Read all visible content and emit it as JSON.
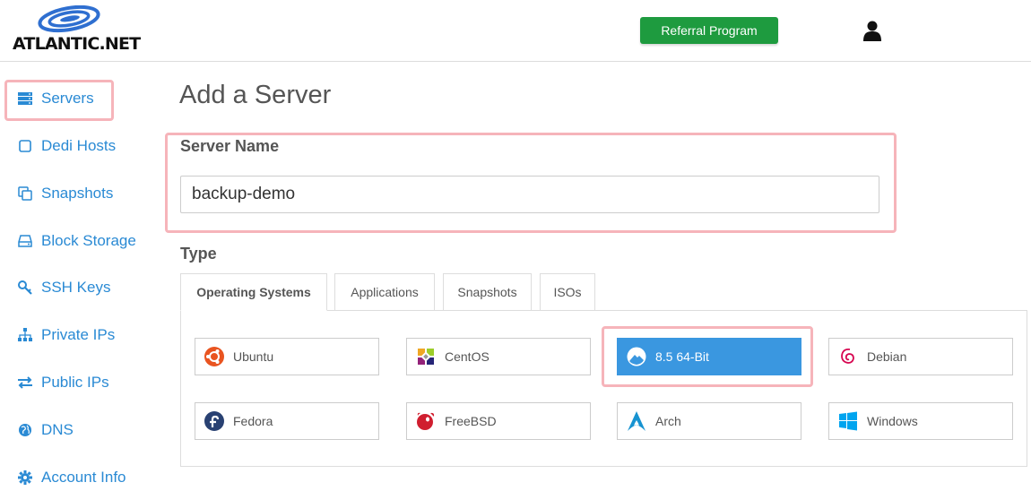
{
  "header": {
    "logo_text": "ATLANTIC.NET",
    "referral_label": "Referral Program",
    "user_icon": "user-icon"
  },
  "sidebar": {
    "items": [
      {
        "label": "Servers",
        "icon": "servers-icon",
        "active": true
      },
      {
        "label": "Dedi Hosts",
        "icon": "square-icon"
      },
      {
        "label": "Snapshots",
        "icon": "copy-icon"
      },
      {
        "label": "Block Storage",
        "icon": "hdd-icon"
      },
      {
        "label": "SSH Keys",
        "icon": "key-icon"
      },
      {
        "label": "Private IPs",
        "icon": "sitemap-icon"
      },
      {
        "label": "Public IPs",
        "icon": "exchange-icon"
      },
      {
        "label": "DNS",
        "icon": "globe-icon"
      },
      {
        "label": "Account Info",
        "icon": "gear-icon"
      }
    ]
  },
  "main": {
    "title": "Add a Server",
    "server_name": {
      "label": "Server Name",
      "value": "backup-demo"
    },
    "type": {
      "label": "Type",
      "tabs": [
        {
          "label": "Operating Systems",
          "active": true
        },
        {
          "label": "Applications"
        },
        {
          "label": "Snapshots"
        },
        {
          "label": "ISOs"
        }
      ],
      "os_options": [
        {
          "label": "Ubuntu",
          "icon": "ubuntu-icon"
        },
        {
          "label": "CentOS",
          "icon": "centos-icon"
        },
        {
          "label": "8.5 64-Bit",
          "icon": "rocky-linux-icon",
          "selected": true
        },
        {
          "label": "Debian",
          "icon": "debian-icon"
        },
        {
          "label": "Fedora",
          "icon": "fedora-icon"
        },
        {
          "label": "FreeBSD",
          "icon": "freebsd-icon"
        },
        {
          "label": "Arch",
          "icon": "arch-icon"
        },
        {
          "label": "Windows",
          "icon": "windows-icon"
        }
      ]
    }
  },
  "colors": {
    "accent": "#2a8ad4",
    "referral_green": "#1e9b3f",
    "selected_os": "#3a97e0",
    "highlight": "#f0828c"
  }
}
